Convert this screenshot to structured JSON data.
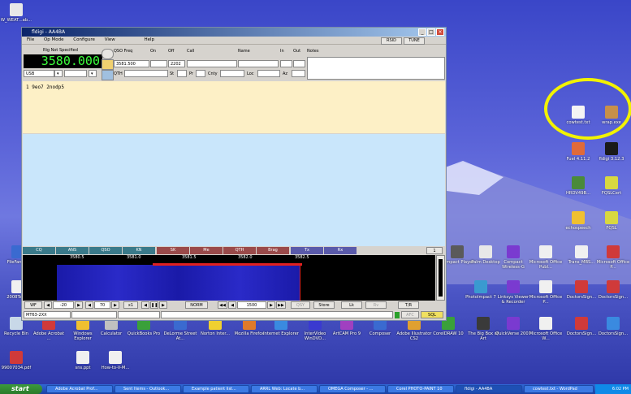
{
  "window": {
    "title": "fldigi - AA4BA",
    "menus": [
      "File",
      "Op Mode",
      "Configure",
      "View",
      "Help"
    ],
    "rsid_label": "RSID",
    "tune_label": "TUNE",
    "rig_label": "Rig Not Specified",
    "frequency": "3580.000",
    "mode": "USB",
    "qso_freq_label": "QSO Freq",
    "qso_freq_value": "3581.500",
    "on_label": "On",
    "off_label": "Off",
    "off_value": "2202",
    "call_label": "Call",
    "name_label": "Name",
    "in_label": "In",
    "out_label": "Out",
    "notes_label": "Notes",
    "qth_label": "QTH",
    "st_label": "St",
    "pr_label": "Pr",
    "cnty_label": "Cnty",
    "loc_label": "Loc",
    "az_label": "Az",
    "rx_text": "1 9eo7 2nodp5",
    "macros": [
      "CQ",
      "ANS",
      "QSO",
      "KN",
      "SK",
      "Me",
      "QTH",
      "Brag",
      "Tx",
      "Rx"
    ],
    "macro_page": "1",
    "scale": [
      "3580.5",
      "3581.0",
      "3581.5",
      "3582.0",
      "3582.5"
    ],
    "controls": {
      "wf_label": "WF",
      "level_value": "-20",
      "range_value": "70",
      "zoom_value": "x1",
      "norm_label": "NORM",
      "offset_value": "1500",
      "qsy_label": "QSY",
      "store_label": "Store",
      "lk_label": "Lk",
      "rv_label": "Rv",
      "tr_label": "T/R"
    },
    "status": {
      "mode": "MT63-2XX",
      "afc_label": "AFC",
      "sql_label": "SQL"
    }
  },
  "desktop": {
    "top_left_icon": "W_WEAT...ab...",
    "right_column": [
      "cowtest.txt",
      "wrap.exe",
      "Fuel 4.11.2",
      "fldigi 3.12.3",
      "HRDV49B...",
      "FQSLCert",
      "echospeech",
      "FQSL"
    ],
    "row1": [
      "FileFarm...",
      "Compact Player",
      "Palm Desktop",
      "Compact Wireless-G",
      "Microsoft Office Publ...",
      "Trans_MBS...",
      "Microsoft Office P..."
    ],
    "row2": [
      "2008Taxes",
      "PhotoImpact 7",
      "Linksys Viewer & Recorder",
      "Microsoft Office P...",
      "DoctorsSign...",
      "DoctorsSign..."
    ],
    "row3": [
      "Recycle Bin",
      "Adobe Acrobat ...",
      "Windows Explorer",
      "Calculator",
      "QuickBooks Pro",
      "DeLorme Street At...",
      "Norton Inter...",
      "Mozilla Firefox",
      "Internet Explorer",
      "InterVideo WinDVD...",
      "ArtCAM Pro 9",
      "Composer",
      "Adobe Illustrator CS2",
      "CorelDRAW 10",
      "The Big Box of Art",
      "QuickVerse 2007",
      "Microsoft Office W...",
      "DoctorsSign...",
      "DoctorsSign..."
    ],
    "row4": [
      "99007034.pdf",
      "sns.ppt",
      "How-to-V-M..."
    ]
  },
  "taskbar": {
    "start_label": "start",
    "buttons": [
      "Adobe Acrobat Prof...",
      "Sent Items - Outlook...",
      "Example patient list...",
      "ARRL Web: Locate b...",
      "OMEGA Composer - ...",
      "Corel PHOTO-PAINT 10",
      "fldigi - AA4BA",
      "cowtest.txt - WordPad"
    ],
    "clock": "6:02 PM"
  },
  "colors": {
    "highlight": "#f2f200",
    "freq": "#3cff3c",
    "rx_bg": "#fdf0c6",
    "tx_bg": "#c9e6fb"
  }
}
